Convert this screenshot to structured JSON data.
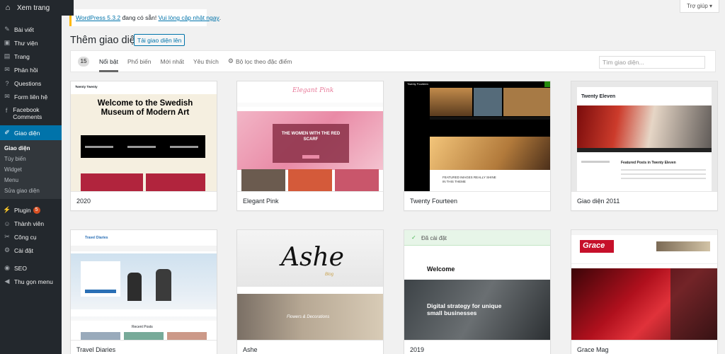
{
  "admin_bar": {
    "visit_site": "Xem trang"
  },
  "sidebar": {
    "items": [
      {
        "label": "Bài viết",
        "icon": "pin-icon"
      },
      {
        "label": "Thư viện",
        "icon": "media-icon"
      },
      {
        "label": "Trang",
        "icon": "page-icon"
      },
      {
        "label": "Phản hồi",
        "icon": "comments-icon"
      },
      {
        "label": "Questions",
        "icon": "questions-icon"
      },
      {
        "label": "Form liên hệ",
        "icon": "mail-icon"
      },
      {
        "label": "Facebook Comments",
        "icon": "facebook-icon"
      },
      {
        "label": "Giao diện",
        "icon": "appearance-icon"
      }
    ],
    "submenu": [
      "Giao diện",
      "Tùy biến",
      "Widget",
      "Menu",
      "Sửa giao diện"
    ],
    "items2": [
      {
        "label": "Plugin",
        "icon": "plugin-icon",
        "badge": "5"
      },
      {
        "label": "Thành viên",
        "icon": "users-icon"
      },
      {
        "label": "Công cụ",
        "icon": "tools-icon"
      },
      {
        "label": "Cài đặt",
        "icon": "settings-icon"
      }
    ],
    "items3": [
      {
        "label": "SEO",
        "icon": "seo-icon"
      },
      {
        "label": "Thu gọn menu",
        "icon": "collapse-icon"
      }
    ]
  },
  "help_tab": "Trợ giúp ▾",
  "notice": {
    "link1": "WordPress 5.3.2",
    "middle": " đang có sẵn! ",
    "link2": "Vui lòng cập nhật ngay",
    "end": "."
  },
  "page_title": "Thêm giao diện",
  "add_new": "Tải giao diện lên",
  "filter": {
    "count": "15",
    "tabs": [
      "Nổi bật",
      "Phổ biến",
      "Mới nhất",
      "Yêu thích"
    ],
    "feature_filter": "Bộ lọc theo đặc điểm",
    "search_placeholder": "Tìm giao diện..."
  },
  "themes": [
    {
      "name": "2020"
    },
    {
      "name": "Elegant Pink"
    },
    {
      "name": "Twenty Fourteen"
    },
    {
      "name": "Giao diện 2011"
    },
    {
      "name": "Travel Diaries"
    },
    {
      "name": "Ashe"
    },
    {
      "name": "2019",
      "installed": "Đã cài đặt"
    },
    {
      "name": "Grace Mag"
    }
  ],
  "previews": {
    "t2020": {
      "site": "Twenty Twenty",
      "headline": "Welcome to the Swedish Museum of Modern Art"
    },
    "pink": {
      "logo": "Elegant Pink",
      "hero": "THE WOMEN WITH THE RED SCARF"
    },
    "t2014": {
      "site": "Twenty Fourteen",
      "post": "FEATURED IMAGES REALLY SHINE IN THIS THEME"
    },
    "t2011": {
      "site": "Twenty Eleven",
      "post": "Featured Posts in Twenty Eleven"
    },
    "travel": {
      "logo": "Travel Diaries",
      "recent": "Recent Posts"
    },
    "ashe": {
      "logo": "Ashe",
      "sub": "Blog",
      "post": "Flowers & Decorations"
    },
    "t2019": {
      "welcome": "Welcome",
      "tagline": "Digital strategy for unique small businesses"
    },
    "grace": {
      "logo": "Grace"
    }
  },
  "colors": {
    "accent": "#0073aa",
    "sidebar": "#23282d",
    "pink": "#e9a0b4",
    "red": "#c6102a",
    "notice": "#ffb900"
  }
}
